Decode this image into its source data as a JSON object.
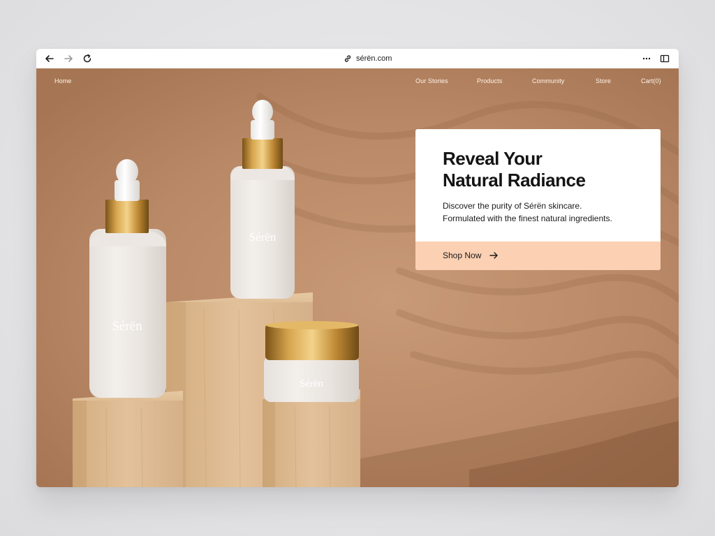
{
  "browser": {
    "url": "sérën.com",
    "icons": {
      "back": "arrow-left-icon",
      "forward": "arrow-right-icon",
      "reload": "reload-icon",
      "link": "link-icon",
      "more": "more-horizontal-icon",
      "sidebar": "sidebar-icon"
    }
  },
  "nav": {
    "home": "Home",
    "items": [
      "Our Stories",
      "Products",
      "Community",
      "Store",
      "Cart(0)"
    ]
  },
  "hero": {
    "title_line1": "Reveal Your",
    "title_line2": "Natural Radiance",
    "subtitle_line1": "Discover the purity of Sérën skincare.",
    "subtitle_line2": "Formulated with the finest natural ingredients.",
    "cta_label": "Shop Now",
    "cta_icon": "arrow-right-icon",
    "brand_on_products": "Sérën"
  },
  "colors": {
    "background": "#b9896a",
    "cta": "#fbd0b3",
    "card": "#ffffff",
    "text": "#141414"
  }
}
